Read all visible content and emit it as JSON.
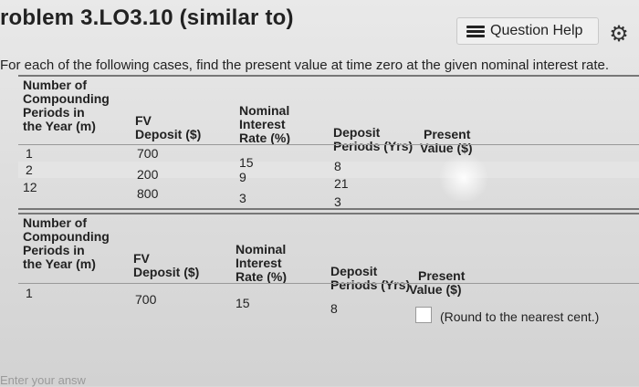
{
  "header": {
    "title": "roblem 3.LO3.10 (similar to)",
    "help_label": "Question Help"
  },
  "instruction": "For each of the following cases, find the present value at time zero at the given nominal interest rate.",
  "table1": {
    "headers": {
      "compounding": [
        "Number of",
        "Compounding",
        "Periods in",
        "the Year (m)"
      ],
      "fv": [
        "FV",
        "Deposit ($)"
      ],
      "rate": [
        "Nominal",
        "Interest",
        "Rate (%)"
      ],
      "periods": [
        "Deposit",
        "Periods (Yrs)"
      ],
      "pv": [
        "Present",
        "Value ($)"
      ]
    },
    "rows": [
      {
        "m": "1",
        "fv": "700",
        "rate": "15",
        "years": "8"
      },
      {
        "m": "2",
        "fv": "200",
        "rate": "9",
        "years": "21"
      },
      {
        "m": "12",
        "fv": "800",
        "rate": "3",
        "years": "3"
      }
    ]
  },
  "table2": {
    "headers": {
      "compounding": [
        "Number of",
        "Compounding",
        "Periods in",
        "the Year (m)"
      ],
      "fv": [
        "FV",
        "Deposit ($)"
      ],
      "rate": [
        "Nominal",
        "Interest",
        "Rate (%)"
      ],
      "periods": [
        "Deposit",
        "Periods (Yrs)"
      ],
      "pv": [
        "Present",
        "Value ($)"
      ]
    },
    "row": {
      "m": "1",
      "fv": "700",
      "rate": "15",
      "years": "8"
    },
    "round_note": "(Round to the nearest cent.)"
  },
  "footer_text": "Enter your answ"
}
